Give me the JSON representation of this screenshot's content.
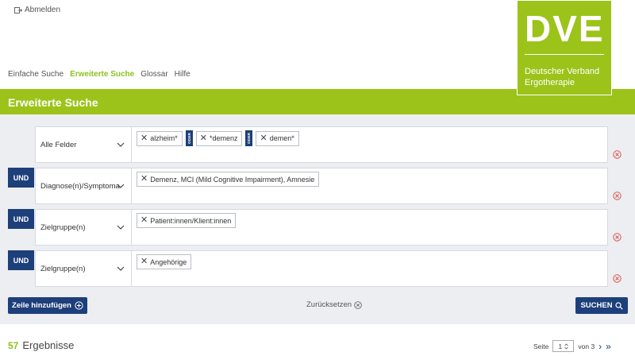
{
  "header": {
    "logout_label": "Abmelden",
    "logo": {
      "mark": "DVE",
      "line1": "Deutscher Verband",
      "line2": "Ergotherapie",
      "color": "#9cc31a"
    }
  },
  "nav": {
    "items": [
      "Einfache Suche",
      "Erweiterte Suche",
      "Glossar",
      "Hilfe"
    ],
    "active": "Erweiterte Suche"
  },
  "page_title": "Erweiterte Suche",
  "query_rows": [
    {
      "operator": "",
      "field": "Alle Felder",
      "tags": [
        "alzheim*",
        "*demenz",
        "demen*"
      ],
      "connector": "ODER"
    },
    {
      "operator": "UND",
      "field": "Diagnose(n)/Symptomatik",
      "tags": [
        "Demenz, MCI (Mild Cognitive Impairment), Amnesie"
      ]
    },
    {
      "operator": "UND",
      "field": "Zielgruppe(n)",
      "tags": [
        "Patient:innen/Klient:innen"
      ]
    },
    {
      "operator": "UND",
      "field": "Zielgruppe(n)",
      "tags": [
        "Angehörige"
      ]
    }
  ],
  "actions": {
    "add_row_label": "Zeile hinzufügen",
    "reset_label": "Zurücksetzen",
    "search_label": "SUCHEN"
  },
  "results": {
    "count": "57",
    "label": "Ergebnisse"
  },
  "pagination": {
    "page_label": "Seite",
    "current_page": "1",
    "of_label": "von 3"
  },
  "colors": {
    "accent_green": "#9cc31a",
    "navy": "#1d3f7a",
    "remove_red": "#d9534f"
  }
}
